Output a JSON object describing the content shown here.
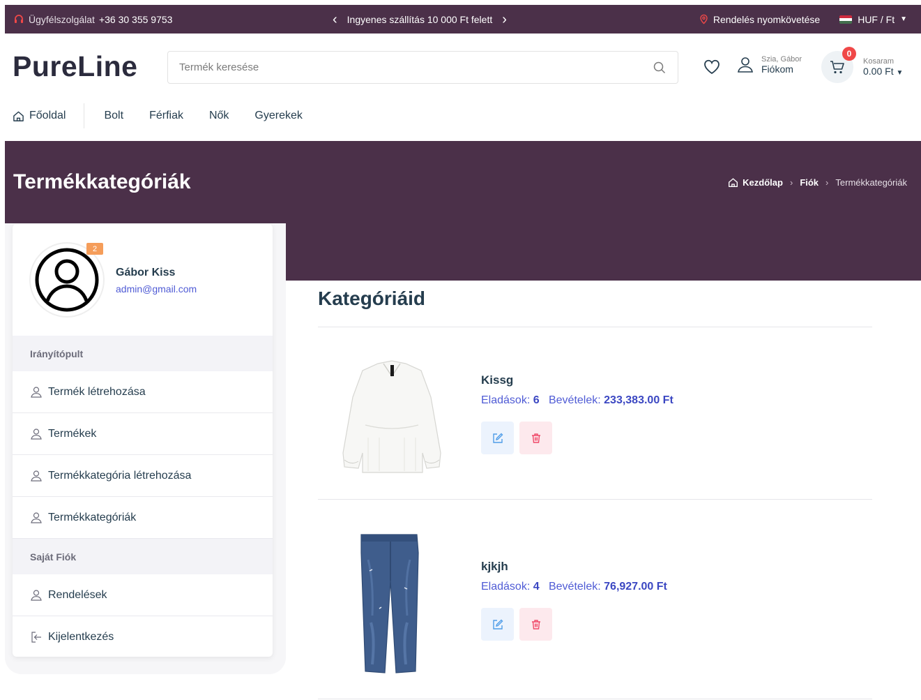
{
  "topbar": {
    "support_label": "Ügyfélszolgálat",
    "phone": "+36 30 355 9753",
    "promo": "Ingyenes szállítás 10 000 Ft felett",
    "tracking": "Rendelés nyomkövetése",
    "currency": "HUF / Ft"
  },
  "header": {
    "logo": "PureLine",
    "search_placeholder": "Termék keresése",
    "greeting": "Szia, Gábor",
    "account_label": "Fiókom",
    "cart_count": "0",
    "cart_label": "Kosaram",
    "cart_total": "0.00 Ft"
  },
  "nav": {
    "home": "Főoldal",
    "items": [
      "Bolt",
      "Férfiak",
      "Nők",
      "Gyerekek"
    ]
  },
  "hero": {
    "title": "Termékkategóriák",
    "breadcrumb": [
      "Kezdőlap",
      "Fiók",
      "Termékkategóriák"
    ]
  },
  "sidebar": {
    "badge": "2",
    "name": "Gábor Kiss",
    "email": "admin@gmail.com",
    "section_dashboard": "Irányítópult",
    "dashboard_items": [
      "Termék létrehozása",
      "Termékek",
      "Termékkategória létrehozása",
      "Termékkategóriák"
    ],
    "section_account": "Saját Fiók",
    "orders": "Rendelések",
    "logout": "Kijelentkezés"
  },
  "main": {
    "title": "Kategóriáid",
    "sales_label": "Eladások:",
    "revenue_label": "Bevételek:",
    "categories": [
      {
        "name": "Kissg",
        "sales": "6",
        "revenue": "233,383.00 Ft",
        "image": "white-blouse"
      },
      {
        "name": "kjkjh",
        "sales": "4",
        "revenue": "76,927.00 Ft",
        "image": "blue-jeans"
      }
    ]
  },
  "colors": {
    "brand_dark": "#4b3049",
    "link_blue": "#4f5bd5",
    "danger": "#f04848",
    "badge_orange": "#f59d5a"
  }
}
